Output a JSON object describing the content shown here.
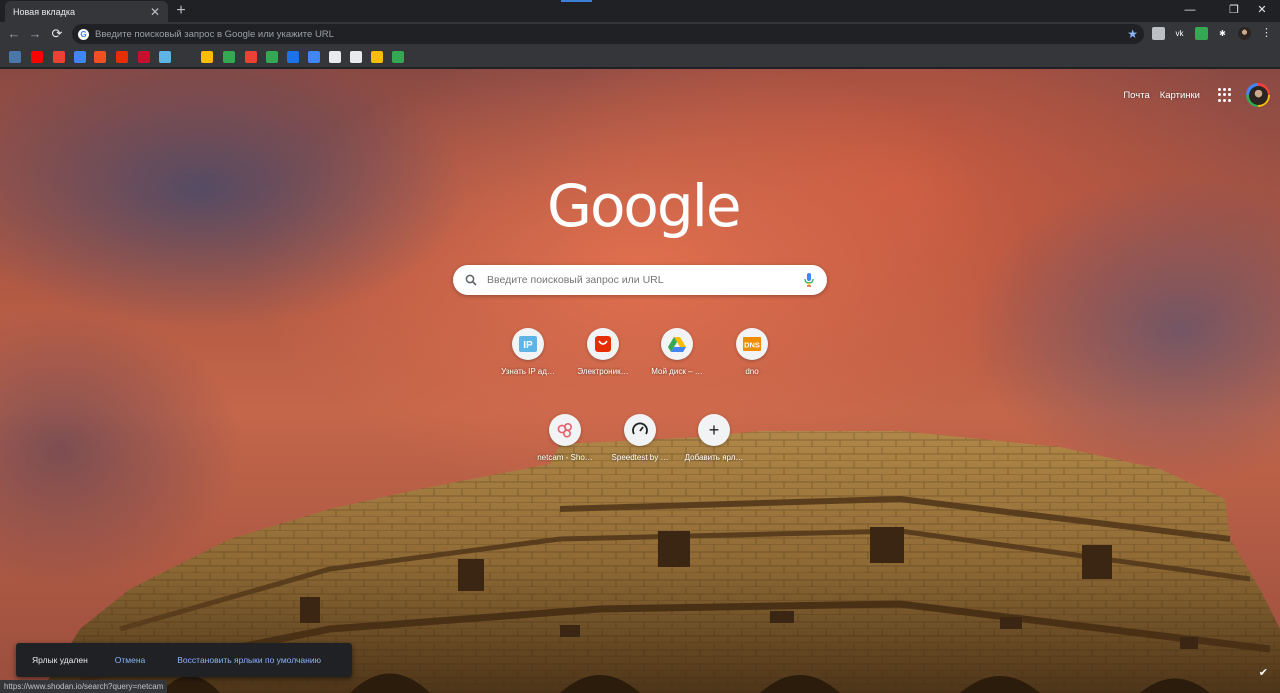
{
  "tab": {
    "title": "Новая вкладка",
    "close": "✕",
    "new_tab": "+"
  },
  "window_controls": {
    "minimize": "—",
    "restore": "❐",
    "close": "✕"
  },
  "toolbar": {
    "back": "←",
    "forward": "→",
    "reload": "⟳",
    "omnibox_placeholder": "Введите поисковый запрос в Google или укажите URL",
    "star": "★"
  },
  "extensions": [
    {
      "name": "extension-tile-icon",
      "color": "#bdc1c6"
    },
    {
      "name": "vk-icon",
      "glyph": "vk",
      "color": "#35363a"
    },
    {
      "name": "shield-extension-icon",
      "color": "#34a853"
    },
    {
      "name": "puzzle-extensions-icon",
      "glyph": "✱",
      "color": "#35363a"
    }
  ],
  "bookmarks": [
    {
      "name": "vk-bookmark-icon",
      "color": "#4a76a8"
    },
    {
      "name": "youtube-bookmark-icon",
      "color": "#ff0000"
    },
    {
      "name": "gmail-bookmark-icon",
      "color": "#ea4335"
    },
    {
      "name": "docs-bookmark-icon",
      "color": "#4285f4"
    },
    {
      "name": "microsoft-bookmark-icon",
      "color": "#f25022"
    },
    {
      "name": "aliexpress-bookmark-icon",
      "color": "#e62e04"
    },
    {
      "name": "shodan-bookmark-icon",
      "color": "#c8102e"
    },
    {
      "name": "ip-bookmark-icon",
      "color": "#5fb4e6"
    },
    {
      "name": "colorful-bookmark-icon",
      "color": "#fbbc05"
    },
    {
      "name": "photos-bookmark-icon",
      "color": "#34a853"
    },
    {
      "name": "gmail-bookmark-icon-2",
      "color": "#ea4335"
    },
    {
      "name": "maps-bookmark-icon",
      "color": "#34a853"
    },
    {
      "name": "wave-bookmark-icon",
      "color": "#1a73e8"
    },
    {
      "name": "google-doc-bookmark-icon",
      "color": "#4285f4"
    },
    {
      "name": "scanner-bookmark-icon",
      "color": "#e8eaed"
    },
    {
      "name": "github-bookmark-icon",
      "color": "#e8eaed"
    },
    {
      "name": "maps-bookmark-icon-2",
      "color": "#fbbc05"
    },
    {
      "name": "drive-bookmark-icon",
      "color": "#34a853"
    }
  ],
  "header": {
    "mail_link": "Почта",
    "images_link": "Картинки"
  },
  "logo": "Google",
  "search": {
    "placeholder": "Введите поисковый запрос или URL"
  },
  "shortcuts": [
    {
      "label": "Узнать IP ад…",
      "icon": "ip-icon"
    },
    {
      "label": "Электроник…",
      "icon": "aliexpress-icon"
    },
    {
      "label": "Мой диск – …",
      "icon": "drive-icon"
    },
    {
      "label": "dno",
      "icon": "dns-icon"
    },
    {
      "label": "netcam - Sho…",
      "icon": "shodan-icon"
    },
    {
      "label": "Speedtest by …",
      "icon": "speedtest-icon"
    },
    {
      "label": "Добавить ярл…",
      "icon": "plus-icon"
    }
  ],
  "icon_text": {
    "ip": "IP",
    "dns": "DNS",
    "plus": "+"
  },
  "toast": {
    "message": "Ярлык удален",
    "undo": "Отмена",
    "restore": "Восстановить ярлыки по умолчанию"
  },
  "status_bar": "https://www.shodan.io/search?query=netcam",
  "customize_icon": "✔"
}
